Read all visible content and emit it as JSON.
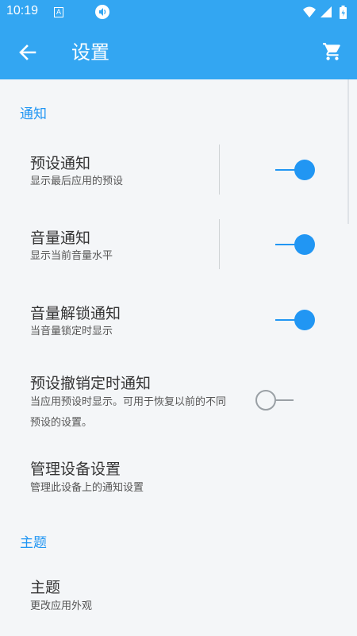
{
  "status_bar": {
    "time": "10:19",
    "notification_icons": [
      "a-icon",
      "volume-icon"
    ],
    "system_icons": [
      "wifi-icon",
      "signal-icon",
      "battery-icon"
    ]
  },
  "app_bar": {
    "title": "设置",
    "back_icon": "arrow-left-icon",
    "cart_icon": "cart-icon"
  },
  "colors": {
    "primary": "#33a6f2",
    "accent": "#2196f3",
    "background": "#f4f6f8"
  },
  "sections": [
    {
      "title": "通知",
      "items": [
        {
          "title": "预设通知",
          "subtitle": "显示最后应用的预设",
          "switch": true
        },
        {
          "title": "音量通知",
          "subtitle": "显示当前音量水平",
          "switch": true
        },
        {
          "title": "音量解锁通知",
          "subtitle": "当音量锁定时显示",
          "switch": true
        },
        {
          "title": "预设撤销定时通知",
          "subtitle_line1": "当应用预设时显示。可用于恢复以前的不同",
          "subtitle_line2": "预设的设置。",
          "switch": false
        },
        {
          "title": "管理设备设置",
          "subtitle": "管理此设备上的通知设置"
        }
      ]
    },
    {
      "title": "主题",
      "items": [
        {
          "title": "主题",
          "subtitle": "更改应用外观"
        }
      ]
    }
  ]
}
